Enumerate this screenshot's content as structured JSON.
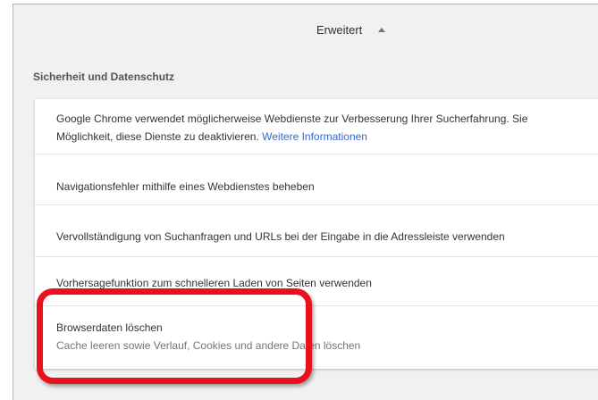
{
  "advanced": {
    "label": "Erweitert",
    "expanded": true
  },
  "section": {
    "title": "Sicherheit und Datenschutz"
  },
  "rows": [
    {
      "line1": "Google Chrome verwendet möglicherweise Webdienste zur Verbesserung Ihrer Sucherfahrung. Sie",
      "line2": "Möglichkeit, diese Dienste zu deaktivieren.",
      "link": "Weitere Informationen"
    },
    {
      "label": "Navigationsfehler mithilfe eines Webdienstes beheben"
    },
    {
      "label": "Vervollständigung von Suchanfragen und URLs bei der Eingabe in die Adressleiste verwenden"
    },
    {
      "label": "Vorhersagefunktion zum schnelleren Laden von Seiten verwenden"
    },
    {
      "label": "Browserdaten löschen",
      "sublabel": "Cache leeren sowie Verlauf, Cookies und andere Daten löschen"
    }
  ],
  "colors": {
    "highlight": "#e8111d",
    "link": "#3367d6",
    "background": "#f1f1f1"
  }
}
